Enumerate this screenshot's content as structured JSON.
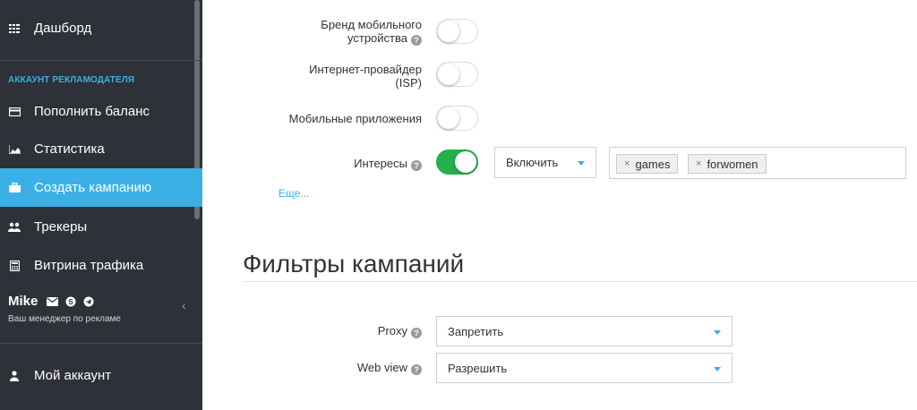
{
  "sidebar": {
    "dashboard": "Дашборд",
    "section_label": "АККАУНТ РЕКЛАМОДАТЕЛЯ",
    "items": [
      {
        "label": "Пополнить баланс",
        "icon": "credit-card-icon"
      },
      {
        "label": "Статистика",
        "icon": "area-chart-icon"
      },
      {
        "label": "Создать кампанию",
        "icon": "briefcase-icon",
        "active": true
      },
      {
        "label": "Трекеры",
        "icon": "users-icon"
      },
      {
        "label": "Витрина трафика",
        "icon": "calculator-icon"
      }
    ],
    "manager": {
      "name": "Mike",
      "subtitle": "Ваш менеджер по рекламе"
    },
    "my_account": "Мой аккаунт"
  },
  "targeting": {
    "device_brand_label_1": "Бренд мобильного",
    "device_brand_label_2": "устройства",
    "isp_label_1": "Интернет-провайдер",
    "isp_label_2": "(ISP)",
    "mobile_apps_label": "Мобильные приложения",
    "interests_label": "Интересы",
    "interests_mode": "Включить",
    "interests_tags": [
      "games",
      "forwomen"
    ],
    "more_link": "Еще..."
  },
  "filters": {
    "title": "Фильтры кампаний",
    "proxy_label": "Proxy",
    "proxy_value": "Запретить",
    "webview_label": "Web view",
    "webview_value": "Разрешить"
  },
  "colors": {
    "sidebar_bg": "#2e3138",
    "accent": "#3bb0e6",
    "toggle_on": "#26b04b"
  }
}
